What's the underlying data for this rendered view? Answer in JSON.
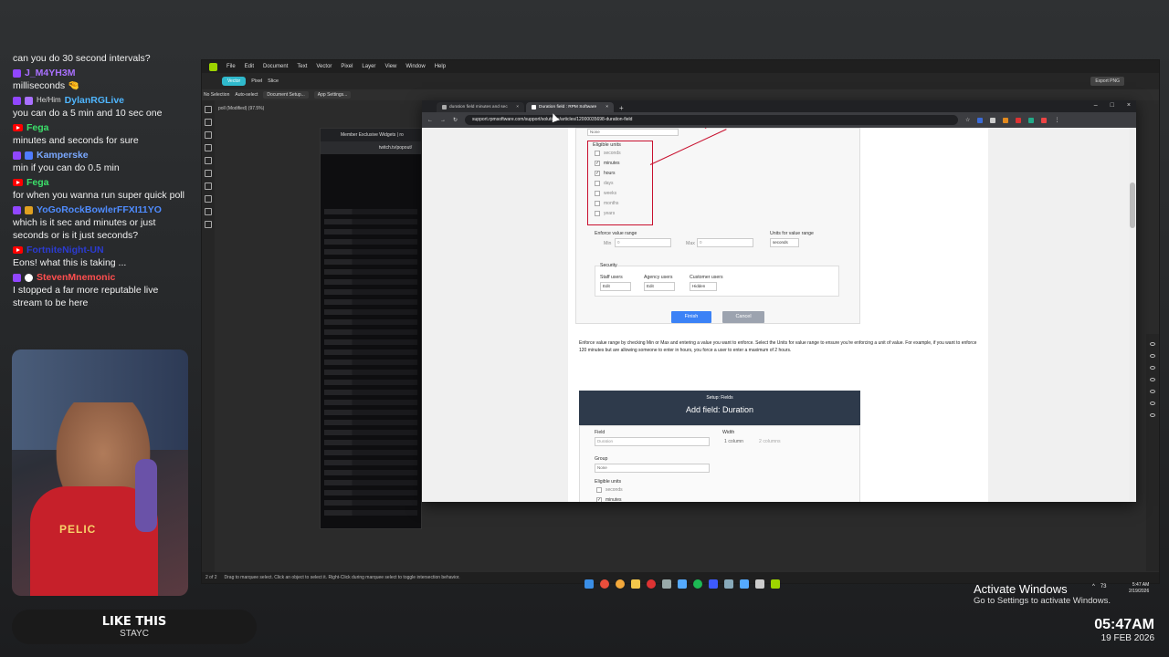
{
  "chat": {
    "messages": [
      {
        "user": "",
        "badges": [],
        "text": "can you do 30 second intervals?",
        "color": "#ffffff"
      },
      {
        "user": "J_M4YH3M",
        "badges": [
          "twitch"
        ],
        "text": "milliseconds 🤏",
        "color": "#a970ff"
      },
      {
        "user": "DylanRGLive",
        "badges": [
          "twitch",
          "sub"
        ],
        "pronoun": "He/Him",
        "text": "you can do a 5 min and 10 sec one",
        "color": "#4fb6ff"
      },
      {
        "user": "Fega",
        "badges": [
          "youtube"
        ],
        "text": "minutes and seconds for sure",
        "color": "#3ce06a"
      },
      {
        "user": "Kamperske",
        "badges": [
          "twitch",
          "prime"
        ],
        "text": "min if you can do 0.5 min",
        "color": "#7aa8ff"
      },
      {
        "user": "Fega",
        "badges": [
          "youtube"
        ],
        "text": "for when you wanna run super quick poll",
        "color": "#3ce06a"
      },
      {
        "user": "YoGoRockBowlerFFXI11YO",
        "badges": [
          "twitch",
          "bits"
        ],
        "text": "which is it sec and minutes or just seconds or is it just seconds?",
        "color": "#4f8cff"
      },
      {
        "user": "FortniteNight-UN",
        "badges": [
          "youtube"
        ],
        "text": "Eons! what this is taking ...",
        "color": "#2b3bd1"
      },
      {
        "user": "StevenMnemonic",
        "badges": [
          "twitch",
          "skull"
        ],
        "text": "I stopped a far more reputable live stream to be here",
        "color": "#ff4f4f"
      }
    ]
  },
  "webcam": {
    "jersey_text": "PELIC"
  },
  "music": {
    "song": "LIKE THIS",
    "artist": "STAYC"
  },
  "affinity": {
    "menu": [
      "File",
      "Edit",
      "Document",
      "Text",
      "Vector",
      "Pixel",
      "Layer",
      "View",
      "Window",
      "Help"
    ],
    "personas": [
      "Vector",
      "Pixel",
      "Slice"
    ],
    "context": {
      "selection": "No Selection",
      "auto_select": "Auto-select",
      "doc_setup": "Document Setup...",
      "app_settings": "App Settings..."
    },
    "doc_tab": "poll (Modified) (97.5%)",
    "export": "Export PNG",
    "status": {
      "page": "2 of 2",
      "hint": "Drag to marquee select. Click an object to select it. Right-Click during marquee select to toggle intersection behavior."
    }
  },
  "twitch_popout": {
    "tab": "Member Exclusive Widgets | ro",
    "url": "twitch.tv/popout/"
  },
  "browser": {
    "tabs": [
      {
        "title": "duration field minutes and sec",
        "active": false
      },
      {
        "title": "Duration field : RPM Software",
        "active": true
      }
    ],
    "url": "support.rpmsoftware.com/support/solutions/articles/12000035698-duration-field",
    "page": {
      "none_option": "None",
      "eligible_units_title": "Eligible units",
      "units": [
        {
          "label": "seconds",
          "checked": false
        },
        {
          "label": "minutes",
          "checked": true
        },
        {
          "label": "hours",
          "checked": true
        },
        {
          "label": "days",
          "checked": false
        },
        {
          "label": "weeks",
          "checked": false
        },
        {
          "label": "months",
          "checked": false
        },
        {
          "label": "years",
          "checked": false
        }
      ],
      "enforce_title": "Enforce value range",
      "min_label": "Min",
      "max_label": "Max",
      "min_val": "0",
      "max_val": "0",
      "units_range_title": "Units for value range",
      "units_range_val": "seconds",
      "security_title": "Security",
      "staff_users": "Staff users",
      "agency_users": "Agency users",
      "customer_users": "Customer users",
      "staff_val": "Edit",
      "agency_val": "Edit",
      "customer_val": "Hidden",
      "finish": "Finish",
      "cancel": "Cancel",
      "description": "Enforce value range by checking Min or Max and entering a value you want to enforce. Select the Units for value range to ensure you're enforcing a unit of value. For example, if you want to enforce 120 minutes but are allowing someone to enter in hours, you force a user to enter a maximum of 2 hours.",
      "setup_small": "Setup: Fields",
      "setup_big": "Add field: Duration",
      "field_label": "Field",
      "field_value": "Duration",
      "width_label": "Width",
      "width_opt1": "1 column",
      "width_opt2": "2 columns",
      "group_label": "Group",
      "group_value": "None",
      "units2": [
        {
          "label": "seconds",
          "checked": false
        },
        {
          "label": "minutes",
          "checked": true
        },
        {
          "label": "hours",
          "checked": true
        }
      ]
    }
  },
  "windows": {
    "activate_title": "Activate Windows",
    "activate_sub": "Go to Settings to activate Windows.",
    "tray_temp": "73",
    "tray_time": "5:47 AM",
    "tray_date": "2/19/2026"
  },
  "clock": {
    "time": "05:47AM",
    "date": "19 FEB 2026"
  },
  "colors": {
    "accent_red": "#c8102e",
    "finish_blue": "#3b82f6",
    "setup_header": "#2e3a4b",
    "affinity_green": "#9dd400"
  }
}
